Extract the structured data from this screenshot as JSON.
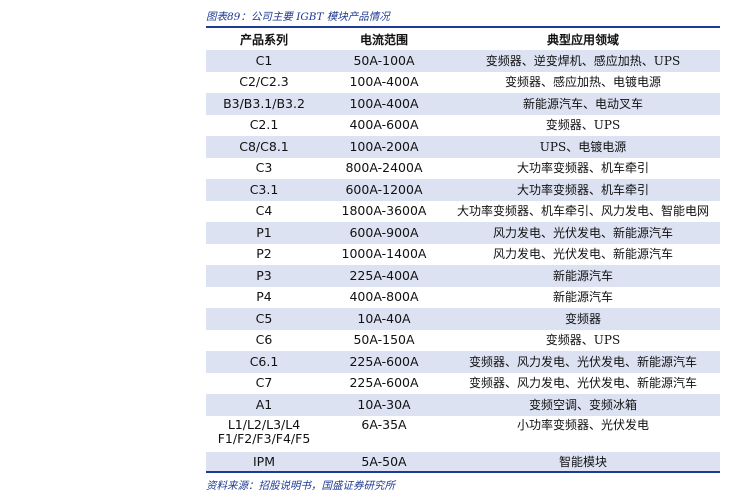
{
  "caption": "图表89：公司主要 IGBT 模块产品情况",
  "headers": [
    "产品系列",
    "电流范围",
    "典型应用领域"
  ],
  "rows": [
    {
      "series": "C1",
      "current": "50A-100A",
      "application": "变频器、逆变焊机、感应加热、UPS"
    },
    {
      "series": "C2/C2.3",
      "current": "100A-400A",
      "application": "变频器、感应加热、电镀电源"
    },
    {
      "series": "B3/B3.1/B3.2",
      "current": "100A-400A",
      "application": "新能源汽车、电动叉车"
    },
    {
      "series": "C2.1",
      "current": "400A-600A",
      "application": "变频器、UPS"
    },
    {
      "series": "C8/C8.1",
      "current": "100A-200A",
      "application": "UPS、电镀电源"
    },
    {
      "series": "C3",
      "current": "800A-2400A",
      "application": "大功率变频器、机车牵引"
    },
    {
      "series": "C3.1",
      "current": "600A-1200A",
      "application": "大功率变频器、机车牵引"
    },
    {
      "series": "C4",
      "current": "1800A-3600A",
      "application": "大功率变频器、机车牵引、风力发电、智能电网"
    },
    {
      "series": "P1",
      "current": "600A-900A",
      "application": "风力发电、光伏发电、新能源汽车"
    },
    {
      "series": "P2",
      "current": "1000A-1400A",
      "application": "风力发电、光伏发电、新能源汽车"
    },
    {
      "series": "P3",
      "current": "225A-400A",
      "application": "新能源汽车"
    },
    {
      "series": "P4",
      "current": "400A-800A",
      "application": "新能源汽车"
    },
    {
      "series": "C5",
      "current": "10A-40A",
      "application": "变频器"
    },
    {
      "series": "C6",
      "current": "50A-150A",
      "application": "变频器、UPS"
    },
    {
      "series": "C6.1",
      "current": "225A-600A",
      "application": "变频器、风力发电、光伏发电、新能源汽车"
    },
    {
      "series": "C7",
      "current": "225A-600A",
      "application": "变频器、风力发电、光伏发电、新能源汽车"
    },
    {
      "series": "A1",
      "current": "10A-30A",
      "application": "变频空调、变频冰箱"
    },
    {
      "series": "L1/L2/L3/L4\nF1/F2/F3/F4/F5",
      "current": "6A-35A",
      "application": "小功率变频器、光伏发电"
    },
    {
      "series": "IPM",
      "current": "5A-50A",
      "application": "智能模块"
    }
  ],
  "source": "资料来源：招股说明书，国盛证券研究所",
  "colors": {
    "accent": "#1f3a93",
    "stripe": "#dde2f3"
  }
}
